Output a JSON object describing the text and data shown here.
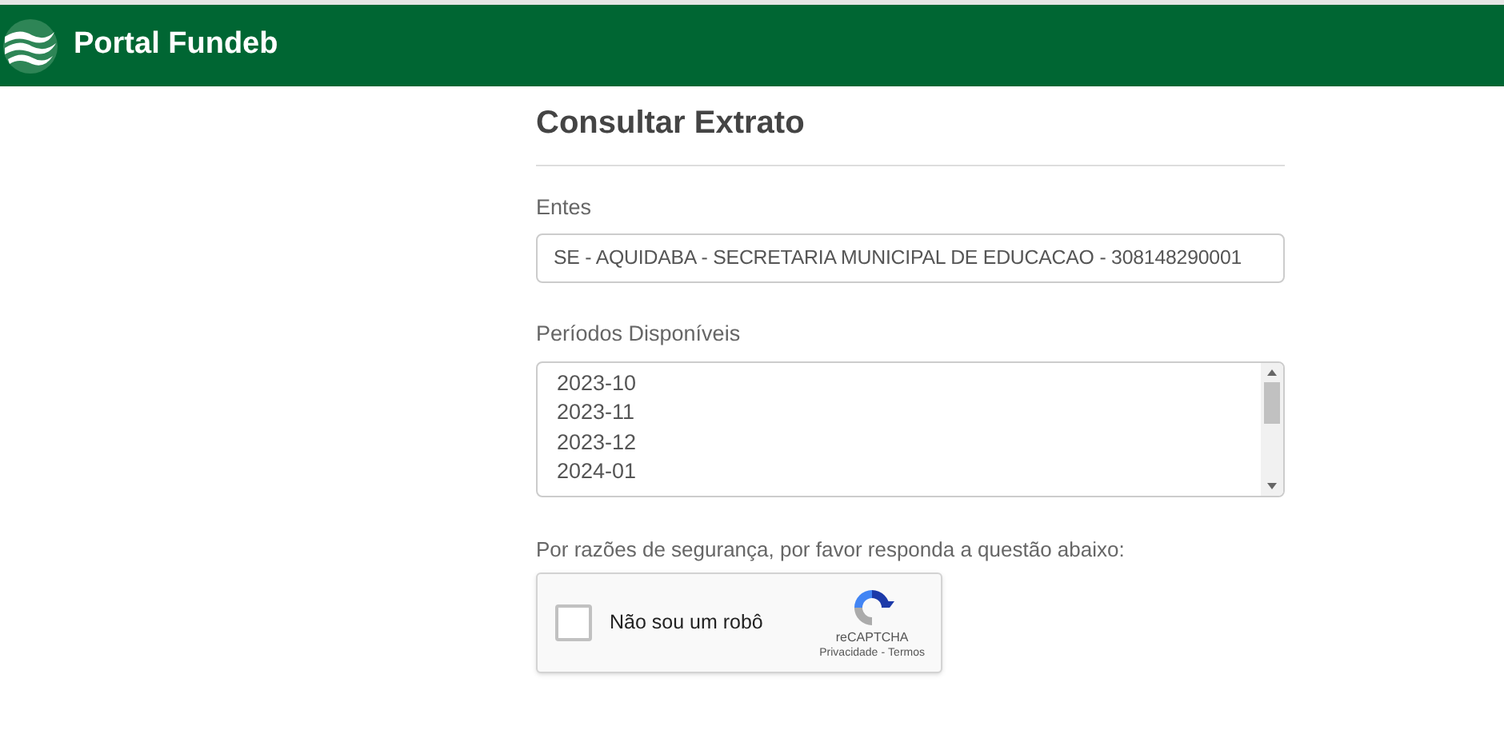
{
  "header": {
    "title": "Portal Fundeb"
  },
  "page_title": "Consultar Extrato",
  "entes": {
    "label": "Entes",
    "value": "SE - AQUIDABA - SECRETARIA MUNICIPAL DE EDUCACAO - 308148290001"
  },
  "periodos": {
    "label": "Períodos Disponíveis",
    "items": [
      {
        "label": "2023-10",
        "selected": false
      },
      {
        "label": "2023-11",
        "selected": false
      },
      {
        "label": "2023-12",
        "selected": false
      },
      {
        "label": "2024-01",
        "selected": false
      }
    ]
  },
  "security_note": "Por razões de segurança, por favor responda a questão abaixo:",
  "captcha": {
    "label": "Não sou um robô",
    "checked": false,
    "brand": "reCAPTCHA",
    "links": [
      "Privacidade",
      "Termos"
    ],
    "separator": "-"
  }
}
